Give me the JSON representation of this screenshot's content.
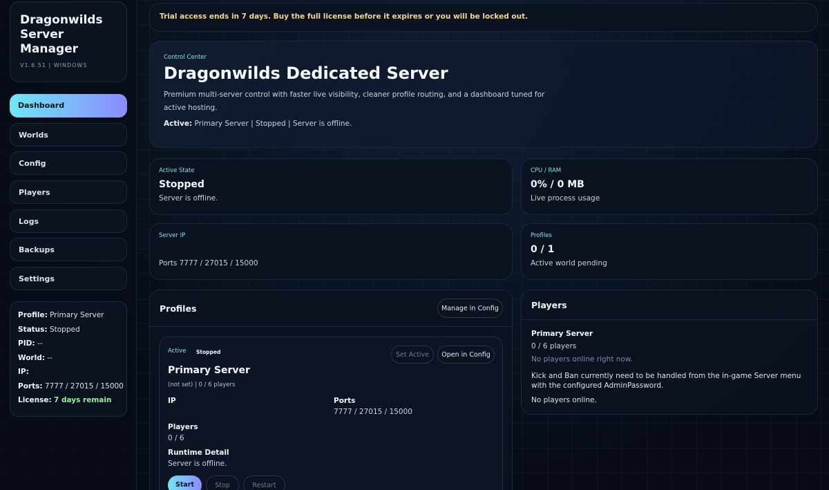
{
  "app": {
    "title": "Dragonwilds Server Manager",
    "version": "V1.6.51 | WINDOWS"
  },
  "nav": [
    {
      "label": "Dashboard"
    },
    {
      "label": "Worlds"
    },
    {
      "label": "Config"
    },
    {
      "label": "Players"
    },
    {
      "label": "Logs"
    },
    {
      "label": "Backups"
    },
    {
      "label": "Settings"
    }
  ],
  "status": {
    "profile_label": "Profile:",
    "profile_value": "Primary Server",
    "status_label": "Status:",
    "status_value": "Stopped",
    "pid_label": "PID:",
    "pid_value": "--",
    "world_label": "World:",
    "world_value": "--",
    "ip_label": "IP:",
    "ip_value": "",
    "ports_label": "Ports:",
    "ports_value": "7777 / 27015 / 15000",
    "license_label": "License:",
    "license_value": "7 days remain"
  },
  "banner": {
    "text": "Trial access ends in 7 days. Buy the full license before it expires or you will be locked out."
  },
  "hero": {
    "eyebrow": "Control Center",
    "title": "Dragonwilds Dedicated Server",
    "description": "Premium multi-server control with faster live visibility, cleaner profile routing, and a dashboard tuned for active hosting.",
    "active_label": "Active:",
    "active_value": "Primary Server | Stopped | Server is offline."
  },
  "stats": {
    "state": {
      "label": "Active State",
      "value": "Stopped",
      "sub": "Server is offline."
    },
    "cpu": {
      "label": "CPU / RAM",
      "value": "0% / 0 MB",
      "sub": "Live process usage"
    },
    "ip": {
      "label": "Server IP",
      "value": "",
      "sub": "Ports 7777 / 27015 / 15000"
    },
    "profiles": {
      "label": "Profiles",
      "value": "0 / 1",
      "sub": "Active world pending"
    }
  },
  "profiles_panel": {
    "title": "Profiles",
    "manage_button": "Manage in Config",
    "card": {
      "active_badge": "Active",
      "state_badge": "Stopped",
      "set_active_button": "Set Active",
      "open_config_button": "Open in Config",
      "name": "Primary Server",
      "meta": "(not set) | 0 / 6 players",
      "ip_label": "IP",
      "ip_value": "",
      "ports_label": "Ports",
      "ports_value": "7777 / 27015 / 15000",
      "players_label": "Players",
      "players_value": "0 / 6",
      "runtime_label": "Runtime Detail",
      "runtime_value": "Server is offline.",
      "start_button": "Start",
      "stop_button": "Stop",
      "restart_button": "Restart"
    }
  },
  "players_panel": {
    "title": "Players",
    "server_name": "Primary Server",
    "count": "0 / 6 players",
    "online_note": "No players online right now.",
    "kick_note": "Kick and Ban currently need to be handled from the in-game Server menu with the configured AdminPassword.",
    "empty": "No players online."
  },
  "colors": {
    "accent_start": "#6ee7f3",
    "accent_end": "#8b8cff",
    "warning": "#f5d68a",
    "success": "#8ff0a4"
  }
}
